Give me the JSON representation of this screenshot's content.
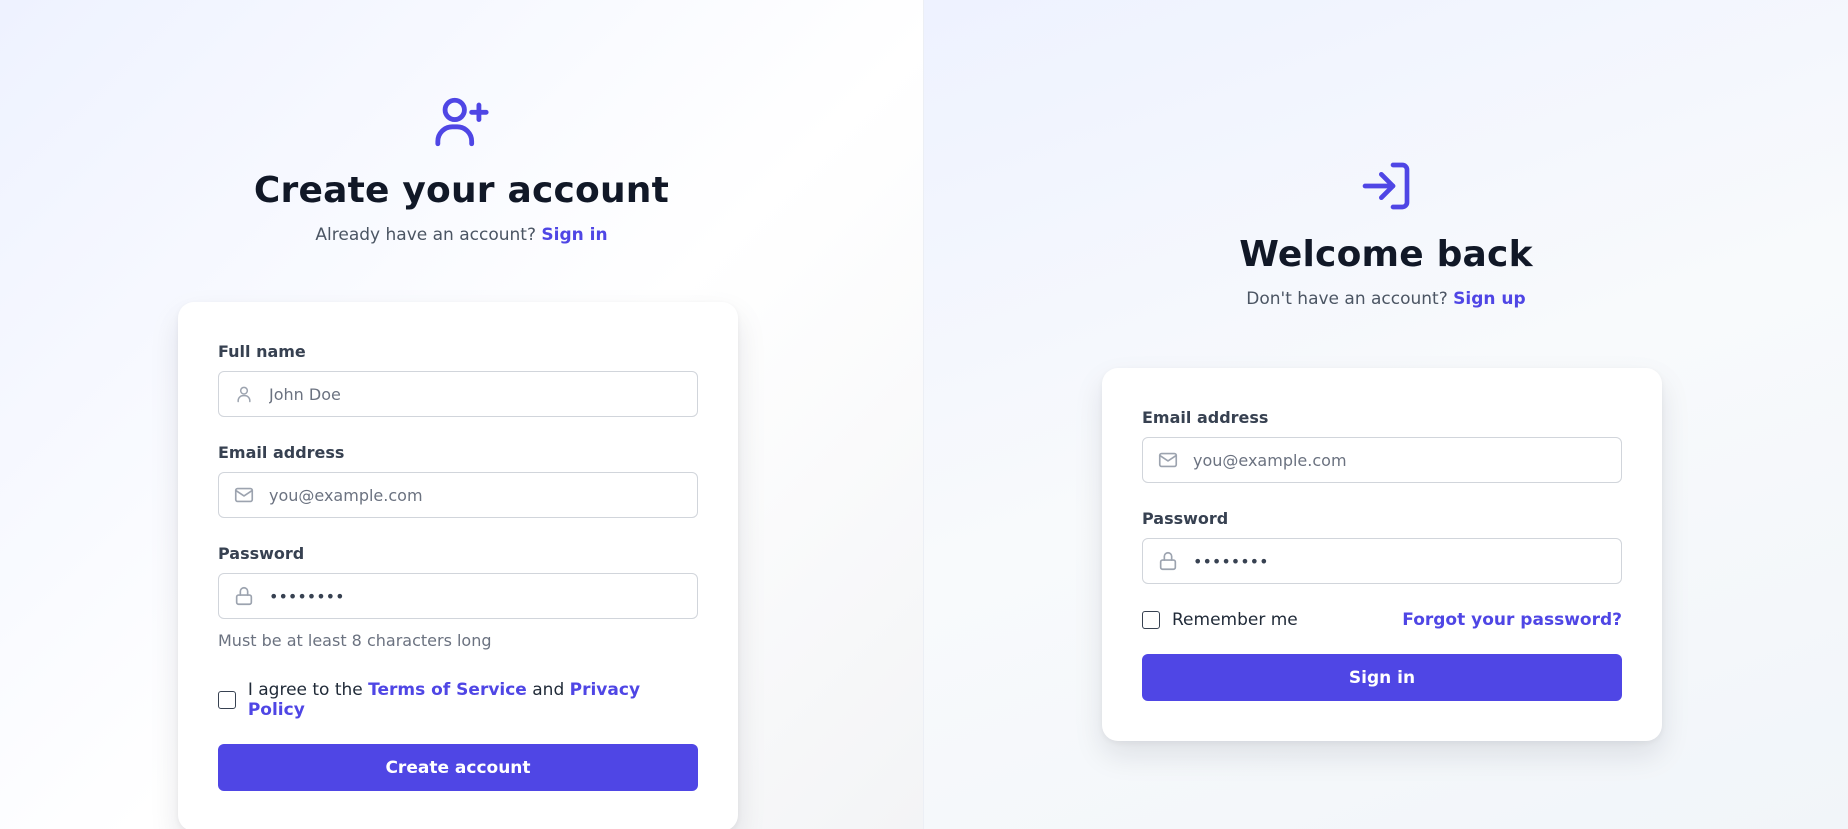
{
  "signup": {
    "title": "Create your account",
    "prompt": "Already have an account?",
    "prompt_link": "Sign in",
    "full_name": {
      "label": "Full name",
      "placeholder": "John Doe"
    },
    "email": {
      "label": "Email address",
      "placeholder": "you@example.com"
    },
    "password": {
      "label": "Password",
      "value": "••••••••",
      "helper": "Must be at least 8 characters long"
    },
    "agree": {
      "prefix": "I agree to the",
      "terms": "Terms of Service",
      "and": "and",
      "privacy": "Privacy Policy"
    },
    "submit": "Create account",
    "icon": "user-plus-icon"
  },
  "signin": {
    "title": "Welcome back",
    "prompt": "Don't have an account?",
    "prompt_link": "Sign up",
    "email": {
      "label": "Email address",
      "placeholder": "you@example.com"
    },
    "password": {
      "label": "Password",
      "value": "••••••••"
    },
    "remember": "Remember me",
    "forgot": "Forgot your password?",
    "submit": "Sign in",
    "icon": "login-icon"
  },
  "colors": {
    "accent": "#4f46e5",
    "text": "#111827",
    "muted": "#6b7280",
    "border": "#d1d5db"
  }
}
